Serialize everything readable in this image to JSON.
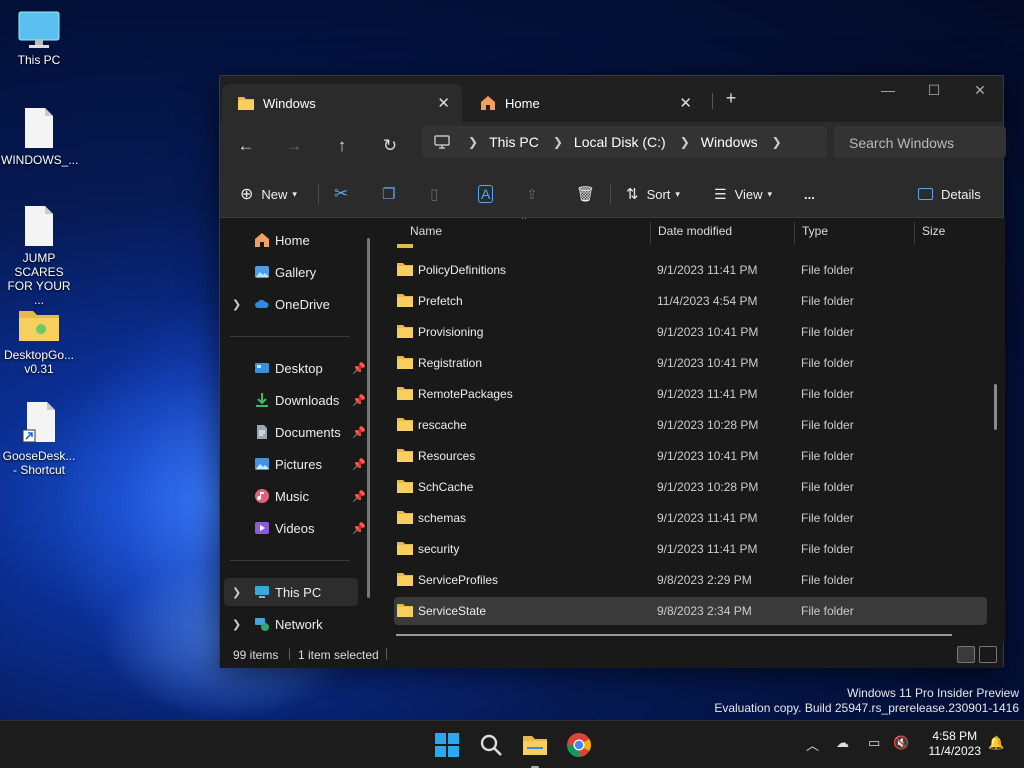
{
  "desktop": {
    "icons": [
      {
        "label": "This PC",
        "icon": "monitor-icon"
      },
      {
        "label": "WINDOWS_...",
        "icon": "file-icon"
      },
      {
        "label": "JUMP SCARES FOR YOUR ...",
        "icon": "file-icon"
      },
      {
        "label": "DesktopGo... v0.31",
        "icon": "folder-icon"
      },
      {
        "label": "GooseDesk... - Shortcut",
        "icon": "shortcut-icon"
      }
    ],
    "watermark_line1": "Windows 11 Pro Insider Preview",
    "watermark_line2": "Evaluation copy. Build 25947.rs_prerelease.230901-1416"
  },
  "explorer": {
    "tabs": [
      {
        "label": "Windows",
        "icon": "folder-icon",
        "active": true
      },
      {
        "label": "Home",
        "icon": "home-icon",
        "active": false
      }
    ],
    "new_tab": "+",
    "window_controls": {
      "minimize": "—",
      "maximize": "☐",
      "close": "✕"
    },
    "breadcrumb": [
      "This PC",
      "Local Disk (C:)",
      "Windows"
    ],
    "search_placeholder": "Search Windows",
    "toolbar": {
      "new": "New",
      "sort": "Sort",
      "view": "View",
      "more": "...",
      "details": "Details"
    },
    "sidebar": {
      "items": [
        {
          "label": "Home",
          "icon": "home-icon",
          "chevron": false,
          "pinned": false
        },
        {
          "label": "Gallery",
          "icon": "gallery-icon",
          "chevron": false,
          "pinned": false
        },
        {
          "label": "OneDrive",
          "icon": "cloud-icon",
          "chevron": true,
          "pinned": false
        },
        {
          "label": "Desktop",
          "icon": "desktop-icon",
          "chevron": false,
          "pinned": true
        },
        {
          "label": "Downloads",
          "icon": "download-icon",
          "chevron": false,
          "pinned": true
        },
        {
          "label": "Documents",
          "icon": "documents-icon",
          "chevron": false,
          "pinned": true
        },
        {
          "label": "Pictures",
          "icon": "pictures-icon",
          "chevron": false,
          "pinned": true
        },
        {
          "label": "Music",
          "icon": "music-icon",
          "chevron": false,
          "pinned": true
        },
        {
          "label": "Videos",
          "icon": "videos-icon",
          "chevron": false,
          "pinned": true
        },
        {
          "label": "This PC",
          "icon": "monitor-icon",
          "chevron": true,
          "pinned": false
        },
        {
          "label": "Network",
          "icon": "network-icon",
          "chevron": true,
          "pinned": false
        }
      ]
    },
    "columns": [
      "Name",
      "Date modified",
      "Type",
      "Size"
    ],
    "files": [
      {
        "name": "PolicyDefinitions",
        "date": "9/1/2023 11:41 PM",
        "type": "File folder",
        "selected": false
      },
      {
        "name": "Prefetch",
        "date": "11/4/2023 4:54 PM",
        "type": "File folder",
        "selected": false
      },
      {
        "name": "Provisioning",
        "date": "9/1/2023 10:41 PM",
        "type": "File folder",
        "selected": false
      },
      {
        "name": "Registration",
        "date": "9/1/2023 10:41 PM",
        "type": "File folder",
        "selected": false
      },
      {
        "name": "RemotePackages",
        "date": "9/1/2023 11:41 PM",
        "type": "File folder",
        "selected": false
      },
      {
        "name": "rescache",
        "date": "9/1/2023 10:28 PM",
        "type": "File folder",
        "selected": false
      },
      {
        "name": "Resources",
        "date": "9/1/2023 10:41 PM",
        "type": "File folder",
        "selected": false
      },
      {
        "name": "SchCache",
        "date": "9/1/2023 10:28 PM",
        "type": "File folder",
        "selected": false
      },
      {
        "name": "schemas",
        "date": "9/1/2023 11:41 PM",
        "type": "File folder",
        "selected": false
      },
      {
        "name": "security",
        "date": "9/1/2023 11:41 PM",
        "type": "File folder",
        "selected": false
      },
      {
        "name": "ServiceProfiles",
        "date": "9/8/2023 2:29 PM",
        "type": "File folder",
        "selected": false
      },
      {
        "name": "ServiceState",
        "date": "9/8/2023 2:34 PM",
        "type": "File folder",
        "selected": true
      }
    ],
    "status": {
      "items": "99 items",
      "selected": "1 item selected"
    }
  },
  "taskbar": {
    "apps": [
      "start-icon",
      "search-icon",
      "file-explorer-icon",
      "chrome-icon"
    ],
    "time": "4:58 PM",
    "date": "11/4/2023"
  }
}
